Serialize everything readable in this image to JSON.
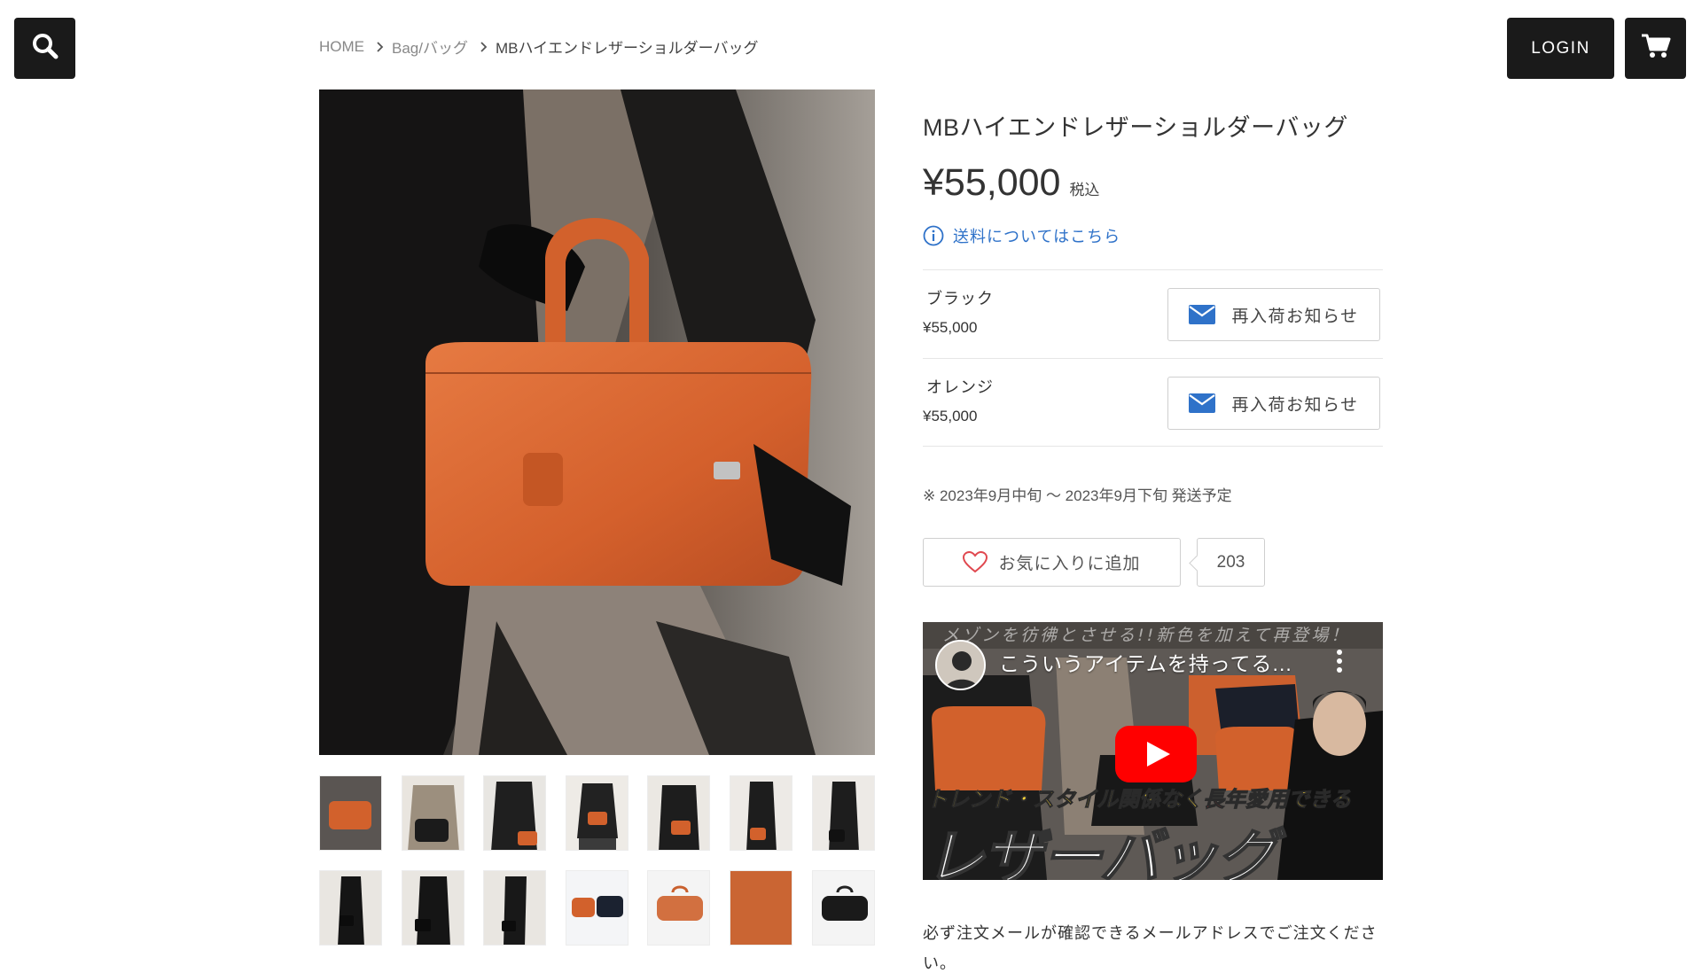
{
  "header": {
    "login_label": "LOGIN",
    "icons": {
      "search": "search-icon",
      "cart": "cart-icon"
    }
  },
  "breadcrumb": {
    "items": [
      "HOME",
      "Bag/バッグ",
      "MBハイエンドレザーショルダーバッグ"
    ]
  },
  "product": {
    "title": "MBハイエンドレザーショルダーバッグ",
    "price": "¥55,000",
    "tax_label": "税込",
    "shipping_link": "送料についてはこちら",
    "variants": [
      {
        "name": "ブラック",
        "price": "¥55,000",
        "button_label": "再入荷お知らせ"
      },
      {
        "name": "オレンジ",
        "price": "¥55,000",
        "button_label": "再入荷お知らせ"
      }
    ],
    "shipping_note": "※ 2023年9月中旬 〜 2023年9月下旬 発送予定",
    "favorite_label": "お気に入りに追加",
    "favorite_count": "203",
    "notice": "必ず注文メールが確認できるメールアドレスでご注文ください。"
  },
  "video": {
    "top_caption": "メゾンを彷彿とさせる!!新色を加えて再登場！",
    "title": "こういうアイテムを持ってる...",
    "overlay_line1_a": "トレンド・スタイル関係なく",
    "overlay_line1_b": "長年愛用",
    "overlay_line1_c": "できる",
    "overlay_line2": "レザーバッグ"
  },
  "colors": {
    "dark_button": "#1a1a1a",
    "link_blue": "#2f72c9",
    "mail_blue": "#2f72c9",
    "heart_red": "#e0484f",
    "bag_orange": "#d8642f",
    "youtube_red": "#ff0000"
  }
}
